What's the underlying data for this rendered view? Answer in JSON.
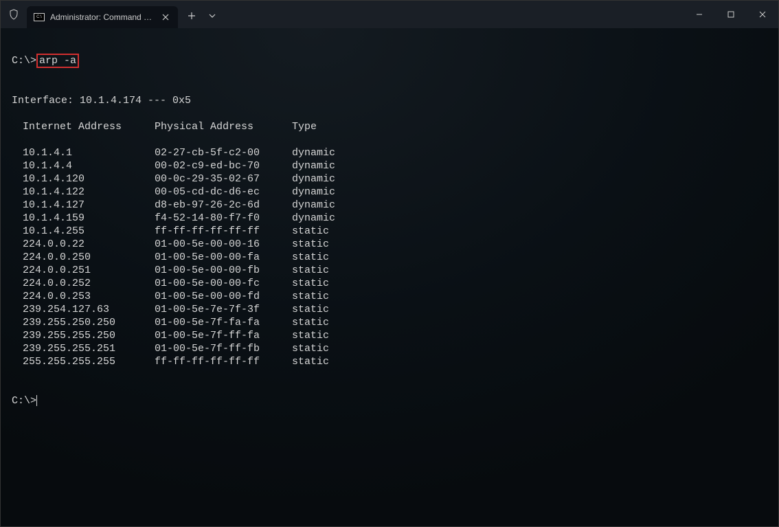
{
  "window": {
    "tab_title": "Administrator: Command Prompt"
  },
  "terminal": {
    "prompt1": "C:\\>",
    "command": "arp -a",
    "blank_after_command": "",
    "interface_line": "Interface: 10.1.4.174 --- 0x5",
    "headers": {
      "ip": "Internet Address",
      "mac": "Physical Address",
      "type": "Type"
    },
    "rows": [
      {
        "ip": "10.1.4.1",
        "mac": "02-27-cb-5f-c2-00",
        "type": "dynamic"
      },
      {
        "ip": "10.1.4.4",
        "mac": "00-02-c9-ed-bc-70",
        "type": "dynamic"
      },
      {
        "ip": "10.1.4.120",
        "mac": "00-0c-29-35-02-67",
        "type": "dynamic"
      },
      {
        "ip": "10.1.4.122",
        "mac": "00-05-cd-dc-d6-ec",
        "type": "dynamic"
      },
      {
        "ip": "10.1.4.127",
        "mac": "d8-eb-97-26-2c-6d",
        "type": "dynamic"
      },
      {
        "ip": "10.1.4.159",
        "mac": "f4-52-14-80-f7-f0",
        "type": "dynamic"
      },
      {
        "ip": "10.1.4.255",
        "mac": "ff-ff-ff-ff-ff-ff",
        "type": "static"
      },
      {
        "ip": "224.0.0.22",
        "mac": "01-00-5e-00-00-16",
        "type": "static"
      },
      {
        "ip": "224.0.0.250",
        "mac": "01-00-5e-00-00-fa",
        "type": "static"
      },
      {
        "ip": "224.0.0.251",
        "mac": "01-00-5e-00-00-fb",
        "type": "static"
      },
      {
        "ip": "224.0.0.252",
        "mac": "01-00-5e-00-00-fc",
        "type": "static"
      },
      {
        "ip": "224.0.0.253",
        "mac": "01-00-5e-00-00-fd",
        "type": "static"
      },
      {
        "ip": "239.254.127.63",
        "mac": "01-00-5e-7e-7f-3f",
        "type": "static"
      },
      {
        "ip": "239.255.250.250",
        "mac": "01-00-5e-7f-fa-fa",
        "type": "static"
      },
      {
        "ip": "239.255.255.250",
        "mac": "01-00-5e-7f-ff-fa",
        "type": "static"
      },
      {
        "ip": "239.255.255.251",
        "mac": "01-00-5e-7f-ff-fb",
        "type": "static"
      },
      {
        "ip": "255.255.255.255",
        "mac": "ff-ff-ff-ff-ff-ff",
        "type": "static"
      }
    ],
    "prompt2": "C:\\>"
  }
}
